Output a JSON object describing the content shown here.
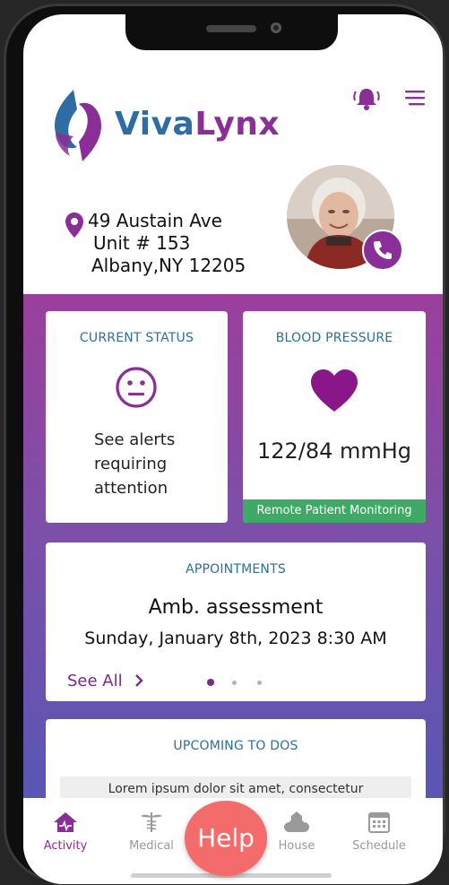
{
  "app": {
    "brand_part1": "Viva",
    "brand_part2": "Lynx"
  },
  "header": {
    "alarm_icon": "bell-alert-icon",
    "menu_icon": "hamburger-menu-icon"
  },
  "patient": {
    "address_line1": "49 Austain Ave",
    "address_line2": "Unit # 153",
    "address_line3": "Albany,NY 12205",
    "call_icon": "phone-icon"
  },
  "status_card": {
    "title": "CURRENT STATUS",
    "icon": "neutral-face-icon",
    "text": "See alerts requiring attention"
  },
  "bp_card": {
    "title": "BLOOD PRESSURE",
    "icon": "heart-icon",
    "value": "122/84 mmHg",
    "footer": "Remote Patient Monitoring"
  },
  "appointments": {
    "title": "APPOINTMENTS",
    "type": "Amb. assessment",
    "datetime": "Sunday, January 8th, 2023 8:30 AM",
    "see_all": "See All",
    "pager": {
      "count": 3,
      "active": 1
    }
  },
  "todos": {
    "title": "UPCOMING TO DOS",
    "preview": "Lorem ipsum dolor sit amet, consectetur"
  },
  "tabs": [
    {
      "label": "Activity",
      "icon": "home-icon",
      "active": true
    },
    {
      "label": "Medical",
      "icon": "caduceus-icon",
      "active": false
    },
    {
      "label": "House",
      "icon": "cloud-house-icon",
      "active": false
    },
    {
      "label": "Schedule",
      "icon": "calendar-icon",
      "active": false
    }
  ],
  "help_button": "Help",
  "colors": {
    "brand_purple": "#8a2f97",
    "brand_blue": "#2e6ca4",
    "rpm_green": "#3faa66",
    "help_red": "#f46b6b"
  }
}
